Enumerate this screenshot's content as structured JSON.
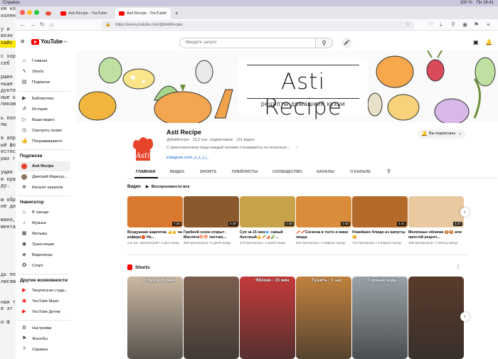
{
  "mac_menubar": {
    "app": "Справка",
    "right": [
      "100 %",
      "Пн 16:41"
    ]
  },
  "behind_window": {
    "lines": [
      "ия ко",
      "колен",
      "",
      "у и",
      "возн",
      "хайс",
      "",
      "с хор",
      "себ",
      "",
      "ршин",
      "ньше",
      "дуктов",
      "ные к",
      "ликом",
      "",
      "ь пол",
      "пы",
      "",
      "в апр",
      "ый фо",
      "естест",
      "рах г",
      "",
      "ущая",
      "в кра",
      "ду.",
      "",
      "м обр",
      "ие ди",
      "",
      "мано,",
      "мента",
      "",
      "",
      "",
      "",
      "",
      "",
      "дь по",
      "лисям",
      "",
      "",
      "ная т",
      "е эт",
      "",
      "и Ш",
      ""
    ]
  },
  "browser": {
    "tabs": [
      {
        "title": "",
        "favicon": "tomato-icon"
      },
      {
        "title": "Asti Recipe - YouTube",
        "active": false
      },
      {
        "title": "Asti Recipe - YouTube",
        "active": true
      }
    ],
    "url": "https://www.youtube.com/@AstiRecipe"
  },
  "youtube": {
    "logo": "YouTube",
    "logo_region": "RU",
    "search_placeholder": "Введите запрос",
    "sidebar": {
      "top": [
        {
          "label": "Главная",
          "icon": "home-icon"
        },
        {
          "label": "Shorts",
          "icon": "shorts-icon"
        },
        {
          "label": "Подписки",
          "icon": "subscriptions-icon"
        }
      ],
      "library": [
        {
          "label": "Библиотека",
          "icon": "library-icon"
        },
        {
          "label": "История",
          "icon": "history-icon"
        },
        {
          "label": "Ваши видео",
          "icon": "your-videos-icon"
        },
        {
          "label": "Смотреть позже",
          "icon": "watch-later-icon"
        },
        {
          "label": "Понравившиеся",
          "icon": "like-icon"
        }
      ],
      "subscriptions_header": "Подписки",
      "subscriptions": [
        {
          "label": "Asti Recipe",
          "active": true
        },
        {
          "label": "Дмитрий Маркуш..."
        },
        {
          "label": "Каталог каналов"
        }
      ],
      "navigator_header": "Навигатор",
      "navigator": [
        {
          "label": "В тренде",
          "icon": "trending-icon"
        },
        {
          "label": "Музыка",
          "icon": "music-icon"
        },
        {
          "label": "Фильмы",
          "icon": "film-icon"
        },
        {
          "label": "Трансляции",
          "icon": "live-icon"
        },
        {
          "label": "Видеоигры",
          "icon": "gaming-icon"
        },
        {
          "label": "Спорт",
          "icon": "sports-icon"
        }
      ],
      "more_header": "Другие возможности",
      "more": [
        {
          "label": "Творческая студи...",
          "icon": "studio-icon"
        },
        {
          "label": "YouTube Music",
          "icon": "yt-music-icon"
        },
        {
          "label": "YouTube Детям",
          "icon": "yt-kids-icon"
        }
      ],
      "bottom": [
        {
          "label": "Настройки",
          "icon": "settings-icon"
        },
        {
          "label": "Жалобы",
          "icon": "flag-icon"
        },
        {
          "label": "Справка",
          "icon": "help-icon"
        }
      ]
    },
    "banner": {
      "title": "Asti Recipe",
      "subtitle": "рецепты домашней кухни"
    },
    "channel": {
      "avatar_text": "Asti",
      "name": "Asti Recipe",
      "handle": "@AstiRecipe",
      "subscribers": "13,2 тыс. подписчиков",
      "videos": "131 видео",
      "description": "С приготовлением пищи каждый человек сталкивается по несколько...",
      "link": "instagram.com/_a_s_t_i_",
      "subscribe_label": "Вы подписаны"
    },
    "tabs": [
      "ГЛАВНАЯ",
      "ВИДЕО",
      "SHORTS",
      "ПЛЕЙЛИСТЫ",
      "СООБЩЕСТВО",
      "КАНАЛЫ",
      "О КАНАЛЕ"
    ],
    "videos_section": {
      "title": "Видео",
      "play_all": "Воспроизвести все"
    },
    "videos": [
      {
        "title": "Воздушная шарлотка 👍👍 на кефире🍎 Не...",
        "views": "2,6 тыс. просмотров",
        "age": "2 дня назад",
        "duration": "7:26",
        "color": "#d9782f"
      },
      {
        "title": "Грибной сезон открыт - Маслята🍄🍄 чистим,...",
        "views": "949 просмотров",
        "age": "5 дней назад",
        "duration": "5:39",
        "color": "#8a5a2e"
      },
      {
        "title": "Суп за 15 мин🥣 самый быстрый👍🥕🌶️🫛...",
        "views": "273 просмотра",
        "age": "6 дней назад",
        "duration": "4:36",
        "color": "#c8a24a"
      },
      {
        "title": "🥓🥓Сосиска в тесте и мини пицца",
        "views": "822 просмотра",
        "age": "3 недели назад",
        "duration": "2:48",
        "color": "#d98c3a"
      },
      {
        "title": "Новейшее блюдо из капусты😋",
        "views": "723 просмотра",
        "age": "3 недели назад",
        "duration": "4:41",
        "color": "#b36a2a"
      },
      {
        "title": "Молочные облачка 🍪🍪 или простой рецепт...",
        "views": "108 просмотров",
        "age": "1 месяц назад",
        "duration": "4:27",
        "color": "#e8c9a0"
      }
    ],
    "shorts_section": {
      "title": "Shorts"
    },
    "shorts": [
      {
        "caption": "В тепле\n15 мин",
        "color": "#cbb9a3"
      },
      {
        "caption": "",
        "color": "#7b5f4e"
      },
      {
        "caption": "Яблоки - 15 мин",
        "color": "#c43a3a"
      },
      {
        "caption": "Тушить - 1 час",
        "color": "#c2823d"
      },
      {
        "caption": "Горячая вода",
        "color": "#9aa3a8"
      },
      {
        "caption": "",
        "color": "#5a3b2b"
      }
    ]
  }
}
